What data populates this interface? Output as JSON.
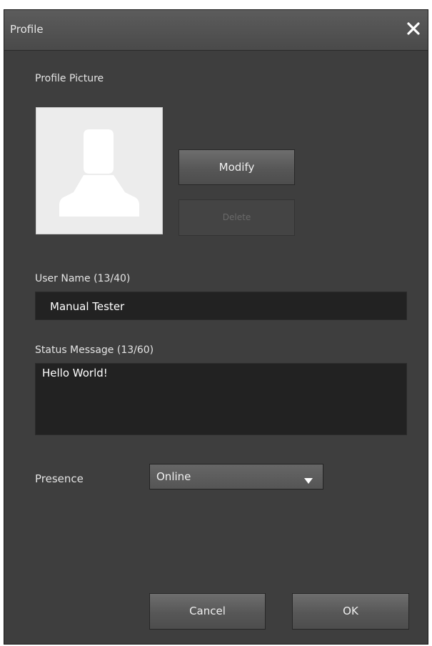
{
  "window": {
    "title": "Profile"
  },
  "profile_picture": {
    "label": "Profile Picture",
    "modify_label": "Modify",
    "delete_label": "Delete"
  },
  "user_name": {
    "label": "User Name (13/40)",
    "value": "Manual Tester"
  },
  "status_message": {
    "label": "Status Message (13/60)",
    "value": "Hello World!"
  },
  "presence": {
    "label": "Presence",
    "selected": "Online"
  },
  "footer": {
    "cancel_label": "Cancel",
    "ok_label": "OK"
  },
  "icons": {
    "close": "close-icon",
    "avatar": "person-silhouette-icon",
    "dropdown": "chevron-down-icon"
  },
  "colors": {
    "dialog_bg": "#3e3e3e",
    "field_bg": "#222222",
    "avatar_bg": "#ececec"
  }
}
